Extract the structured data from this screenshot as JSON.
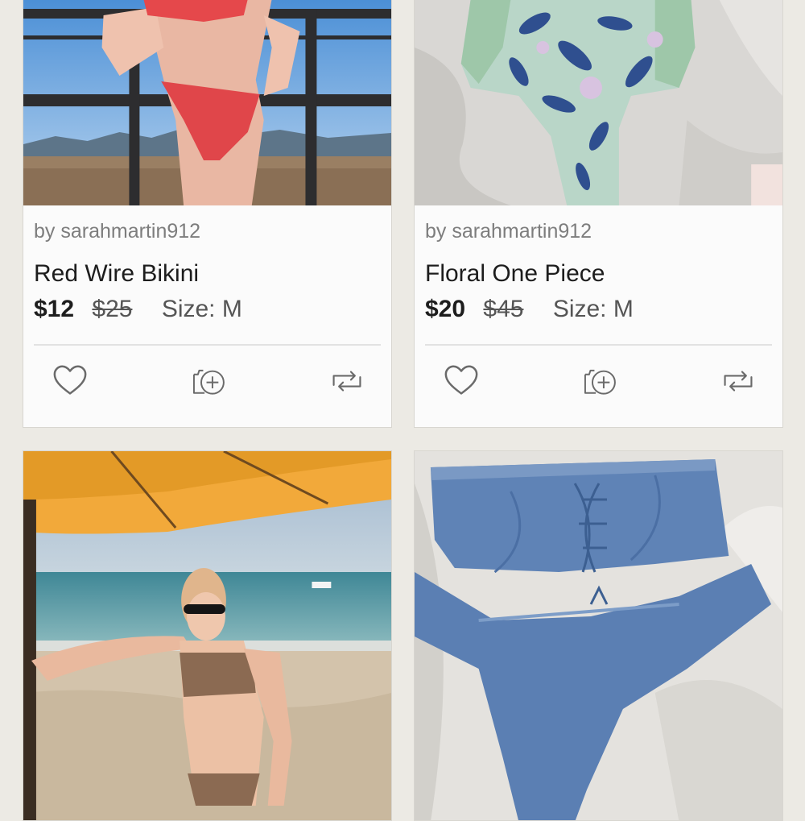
{
  "listings": [
    {
      "seller": "by sarahmartin912",
      "title": "Red Wire Bikini",
      "price": "$12",
      "original_price": "$25",
      "size": "Size: M",
      "photo": "red-bikini-balcony-photo",
      "actions": [
        "heart-icon",
        "add-to-bundle-icon",
        "share-icon"
      ]
    },
    {
      "seller": "by sarahmartin912",
      "title": "Floral One Piece",
      "price": "$20",
      "original_price": "$45",
      "size": "Size: M",
      "photo": "floral-one-piece-photo",
      "actions": [
        "heart-icon",
        "add-to-bundle-icon",
        "share-icon"
      ]
    },
    {
      "photo": "leopard-bikini-beach-photo"
    },
    {
      "photo": "blue-lace-up-bikini-photo"
    }
  ],
  "colors": {
    "background": "#eceae4",
    "card": "#ffffff",
    "text_primary": "#1d1d1d",
    "text_secondary": "#7d7d7d",
    "icon": "#6a6a6a"
  }
}
